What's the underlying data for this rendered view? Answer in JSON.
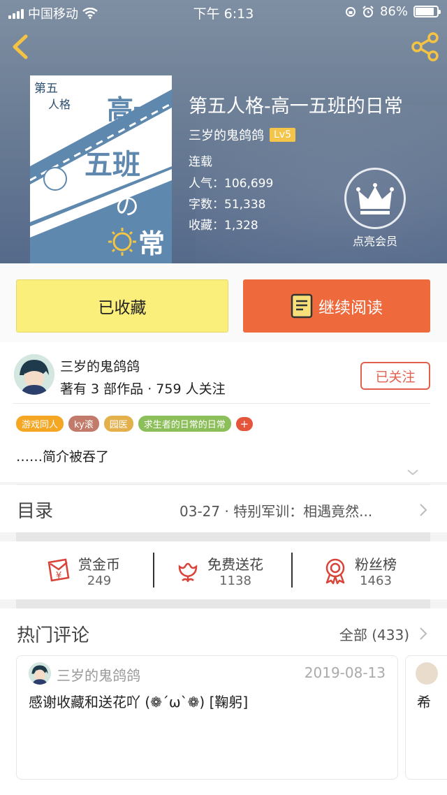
{
  "status_bar": {
    "carrier": "中国移动",
    "time": "下午 6:13",
    "battery": "86%"
  },
  "book": {
    "title": "第五人格-高一五班的日常",
    "author": "三岁的鬼鸽鸽",
    "level": "Lv5",
    "status": "连载",
    "popularity_label": "人气：",
    "popularity": "106,699",
    "words_label": "字数：",
    "words": "51,338",
    "favorites_label": "收藏：",
    "favorites": "1,328",
    "vip_label": "点亮会员",
    "cover_lines": [
      "第五",
      "人格",
      "高一",
      "五班",
      "の",
      "常"
    ]
  },
  "buttons": {
    "favorited": "已收藏",
    "continue_reading": "继续阅读"
  },
  "author_card": {
    "name": "三岁的鬼鸽鸽",
    "works": "著有 3 部作品 · 759 人关注",
    "follow": "已关注",
    "tags": [
      {
        "label": "游戏同人",
        "color": "#f5a623"
      },
      {
        "label": "ky滚",
        "color": "#c27a6a"
      },
      {
        "label": "园医",
        "color": "#e3b04b"
      },
      {
        "label": "求生者的日常的日常",
        "color": "#8cbf5a"
      }
    ],
    "tag_add": "+",
    "intro": "……简介被吞了"
  },
  "toc": {
    "title": "目录",
    "latest": "03-27 · 特别军训：相遇竟然..."
  },
  "actions": [
    {
      "label": "赏金币",
      "count": "249",
      "icon": "red-envelope-icon"
    },
    {
      "label": "免费送花",
      "count": "1138",
      "icon": "flower-icon"
    },
    {
      "label": "粉丝榜",
      "count": "1463",
      "icon": "medal-icon"
    }
  ],
  "comments": {
    "title": "热门评论",
    "all": "全部 (433)",
    "items": [
      {
        "user": "三岁的鬼鸽鸽",
        "date": "2019-08-13",
        "text": "感谢收藏和送花吖 (❁´ω`❁) [鞠躬]"
      },
      {
        "text": "希"
      }
    ]
  },
  "colors": {
    "accent_orange": "#ee6a3d",
    "fav_yellow": "#fbef7c",
    "follow_red": "#e0604d",
    "lv_badge": "#f5c343"
  }
}
